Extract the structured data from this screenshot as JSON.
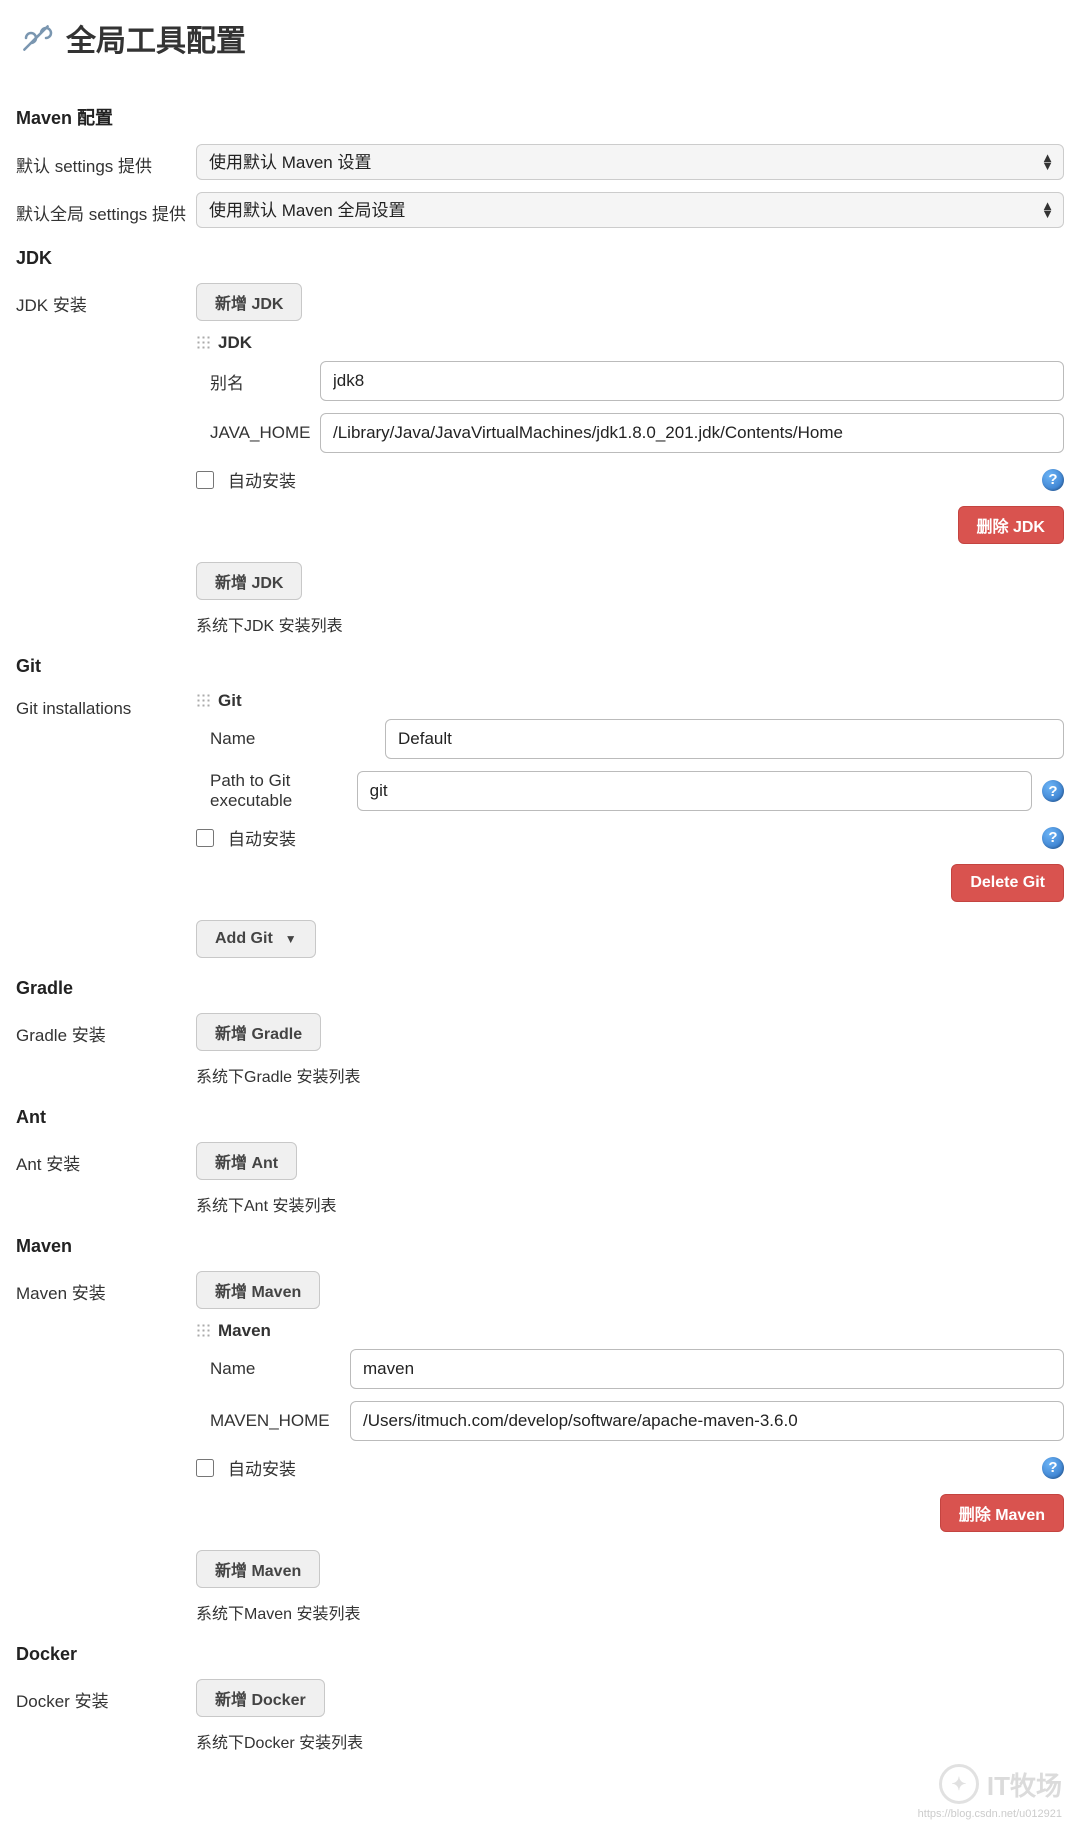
{
  "header": {
    "title": "全局工具配置"
  },
  "maven_config": {
    "section": "Maven 配置",
    "default_settings_label": "默认 settings 提供",
    "default_settings_value": "使用默认 Maven 设置",
    "global_settings_label": "默认全局 settings 提供",
    "global_settings_value": "使用默认 Maven 全局设置"
  },
  "jdk": {
    "section": "JDK",
    "install_label": "JDK 安装",
    "add_button": "新增 JDK",
    "subtitle": "JDK",
    "alias_label": "别名",
    "alias_value": "jdk8",
    "home_label": "JAVA_HOME",
    "home_value": "/Library/Java/JavaVirtualMachines/jdk1.8.0_201.jdk/Contents/Home",
    "auto_install_label": "自动安装",
    "delete_button": "删除 JDK",
    "add_button2": "新增 JDK",
    "list_desc": "系统下JDK 安装列表"
  },
  "git": {
    "section": "Git",
    "install_label": "Git installations",
    "subtitle": "Git",
    "name_label": "Name",
    "name_value": "Default",
    "path_label": "Path to Git executable",
    "path_value": "git",
    "auto_install_label": "自动安装",
    "delete_button": "Delete Git",
    "add_button": "Add Git"
  },
  "gradle": {
    "section": "Gradle",
    "install_label": "Gradle 安装",
    "add_button": "新增 Gradle",
    "list_desc": "系统下Gradle 安装列表"
  },
  "ant": {
    "section": "Ant",
    "install_label": "Ant 安装",
    "add_button": "新增 Ant",
    "list_desc": "系统下Ant 安装列表"
  },
  "maven": {
    "section": "Maven",
    "install_label": "Maven 安装",
    "add_button": "新增 Maven",
    "subtitle": "Maven",
    "name_label": "Name",
    "name_value": "maven",
    "home_label": "MAVEN_HOME",
    "home_value": "/Users/itmuch.com/develop/software/apache-maven-3.6.0",
    "auto_install_label": "自动安装",
    "delete_button": "删除 Maven",
    "add_button2": "新增 Maven",
    "list_desc": "系统下Maven 安装列表"
  },
  "docker": {
    "section": "Docker",
    "install_label": "Docker 安装",
    "add_button": "新增 Docker",
    "list_desc": "系统下Docker 安装列表"
  },
  "watermark": {
    "text": "IT牧场",
    "url": "https://blog.csdn.net/u012921"
  }
}
